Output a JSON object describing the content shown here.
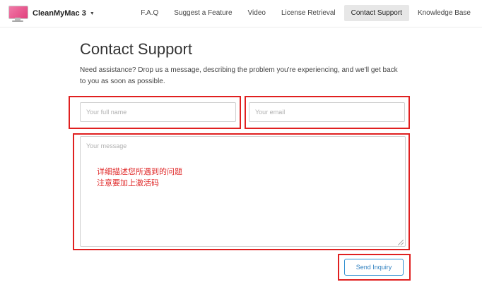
{
  "header": {
    "app_name": "CleanMyMac 3",
    "dropdown_icon": "caret-down-icon",
    "logo_icon": "imac-logo-icon",
    "menu": [
      {
        "label": "F.A.Q",
        "active": false
      },
      {
        "label": "Suggest a Feature",
        "active": false
      },
      {
        "label": "Video",
        "active": false
      },
      {
        "label": "License Retrieval",
        "active": false
      },
      {
        "label": "Contact Support",
        "active": true
      },
      {
        "label": "Knowledge Base",
        "active": false
      }
    ]
  },
  "main": {
    "title": "Contact Support",
    "description": "Need assistance? Drop us a message, describing the problem you're experiencing, and we'll get back to you as soon as possible."
  },
  "form": {
    "name_placeholder": "Your full name",
    "email_placeholder": "Your email",
    "message_placeholder": "Your message",
    "submit_label": "Send Inquiry"
  },
  "annotation": {
    "line1": "详细描述您所遇到的问题",
    "line2": "注意要加上激活码",
    "highlight_color": "#e02020"
  }
}
